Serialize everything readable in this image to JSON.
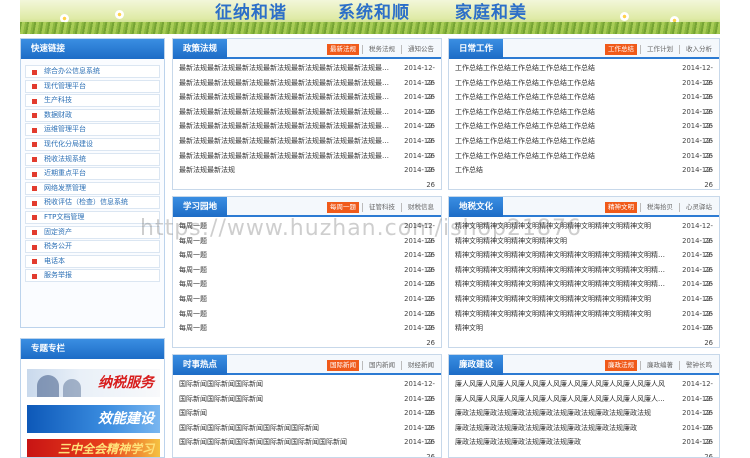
{
  "banner": {
    "slogans": [
      "征纳和谐",
      "系统和顺",
      "家庭和美"
    ]
  },
  "quick_links": {
    "title": "快速链接",
    "items": [
      "综合办公信息系统",
      "现代管理平台",
      "生产科技",
      "数据财政",
      "运维管理平台",
      "现代化分局建设",
      "税收法规系统",
      "近期重点平台",
      "网络发票管理",
      "税收评估（检查）信息系统",
      "FTP文档管理",
      "固定资产",
      "税务公开",
      "电话本",
      "服务举报"
    ]
  },
  "special": {
    "title": "专题专栏",
    "promos": [
      "纳税服务",
      "效能建设",
      "三中全会精神学习"
    ]
  },
  "panels": {
    "policy": {
      "title": "政策法规",
      "tabs": [
        "最新法规",
        "税务法规",
        "通知公告"
      ],
      "rows": [
        {
          "t": "最新法规最新法规最新法规最新法规最新法规最新法规最新法规最新...",
          "d": "2014-12-26"
        },
        {
          "t": "最新法规最新法规最新法规最新法规最新法规最新法规最新法规最新...",
          "d": "2014-12-26"
        },
        {
          "t": "最新法规最新法规最新法规最新法规最新法规最新法规最新法规最新...",
          "d": "2014-12-26"
        },
        {
          "t": "最新法规最新法规最新法规最新法规最新法规最新法规最新法规最新...",
          "d": "2014-12-26"
        },
        {
          "t": "最新法规最新法规最新法规最新法规最新法规最新法规最新法规最新...",
          "d": "2014-12-26"
        },
        {
          "t": "最新法规最新法规最新法规最新法规最新法规最新法规最新法规最新...",
          "d": "2014-12-26"
        },
        {
          "t": "最新法规最新法规最新法规最新法规最新法规最新法规最新法规最新...",
          "d": "2014-12-26"
        },
        {
          "t": "最新法规最新法规",
          "d": "2014-12-26"
        }
      ]
    },
    "daily": {
      "title": "日常工作",
      "tabs": [
        "工作总结",
        "工作计划",
        "收入分析"
      ],
      "rows": [
        {
          "t": "工作总结工作总结工作总结工作总结工作总结",
          "d": "2014-12-26"
        },
        {
          "t": "工作总结工作总结工作总结工作总结工作总结",
          "d": "2014-12-26"
        },
        {
          "t": "工作总结工作总结工作总结工作总结工作总结",
          "d": "2014-12-26"
        },
        {
          "t": "工作总结工作总结工作总结工作总结工作总结",
          "d": "2014-12-26"
        },
        {
          "t": "工作总结工作总结工作总结工作总结工作总结",
          "d": "2014-12-26"
        },
        {
          "t": "工作总结工作总结工作总结工作总结工作总结",
          "d": "2014-12-26"
        },
        {
          "t": "工作总结工作总结工作总结工作总结工作总结",
          "d": "2014-12-26"
        },
        {
          "t": "工作总结",
          "d": "2014-12-26"
        }
      ]
    },
    "study": {
      "title": "学习园地",
      "tabs": [
        "每周一题",
        "征管科技",
        "财税信息"
      ],
      "rows": [
        {
          "t": "每周一题",
          "d": "2014-12-26"
        },
        {
          "t": "每周一题",
          "d": "2014-12-26"
        },
        {
          "t": "每周一题",
          "d": "2014-12-26"
        },
        {
          "t": "每周一题",
          "d": "2014-12-26"
        },
        {
          "t": "每周一题",
          "d": "2014-12-26"
        },
        {
          "t": "每周一题",
          "d": "2014-12-26"
        },
        {
          "t": "每周一题",
          "d": "2014-12-26"
        },
        {
          "t": "每周一题",
          "d": "2014-12-26"
        }
      ]
    },
    "culture": {
      "title": "地税文化",
      "tabs": [
        "精神文明",
        "税海拾贝",
        "心灵驿站"
      ],
      "rows": [
        {
          "t": "精神文明精神文明精神文明精神文明精神文明精神文明精神文明",
          "d": "2014-12-26"
        },
        {
          "t": "精神文明精神文明精神文明精神文明",
          "d": "2014-12-26"
        },
        {
          "t": "精神文明精神文明精神文明精神文明精神文明精神文明精神文明精神...",
          "d": "2014-12-26"
        },
        {
          "t": "精神文明精神文明精神文明精神文明精神文明精神文明精神文明精神...",
          "d": "2014-12-26"
        },
        {
          "t": "精神文明精神文明精神文明精神文明精神文明精神文明精神文明精神...",
          "d": "2014-12-26"
        },
        {
          "t": "精神文明精神文明精神文明精神文明精神文明精神文明精神文明",
          "d": "2014-12-26"
        },
        {
          "t": "精神文明精神文明精神文明精神文明精神文明精神文明精神文明",
          "d": "2014-12-26"
        },
        {
          "t": "精神文明",
          "d": "2014-12-26"
        }
      ]
    },
    "news": {
      "title": "时事热点",
      "tabs": [
        "国际新闻",
        "国内新闻",
        "财经新闻"
      ],
      "rows": [
        {
          "t": "国际新闻国际新闻国际新闻",
          "d": "2014-12-26"
        },
        {
          "t": "国际新闻国际新闻国际新闻",
          "d": "2014-12-26"
        },
        {
          "t": "国际新闻",
          "d": "2014-12-26"
        },
        {
          "t": "国际新闻国际新闻国际新闻国际新闻国际新闻",
          "d": "2014-12-26"
        },
        {
          "t": "国际新闻国际新闻国际新闻国际新闻国际新闻国际新闻",
          "d": "2014-12-26"
        }
      ]
    },
    "clean": {
      "title": "廉政建设",
      "tabs": [
        "廉政法规",
        "廉政编著",
        "警钟长鸣"
      ],
      "rows": [
        {
          "t": "廉人风廉人风廉人风廉人风廉人风廉人风廉人风廉人风廉人风廉人风",
          "d": "2014-12-26"
        },
        {
          "t": "廉人风廉人风廉人风廉人风廉人风廉人风廉人风廉人风廉人风廉人...",
          "d": "2014-12-26"
        },
        {
          "t": "廉政法规廉政法规廉政法规廉政法规廉政法规廉政法规廉政法规",
          "d": "2014-12-26"
        },
        {
          "t": "廉政法规廉政法规廉政法规廉政法规廉政法规廉政法规廉政",
          "d": "2014-12-26"
        },
        {
          "t": "廉政法规廉政法规廉政法规廉政法规廉政",
          "d": "2014-12-26"
        }
      ]
    }
  },
  "watermark": "https://www.huzhan.com/ishop21876"
}
